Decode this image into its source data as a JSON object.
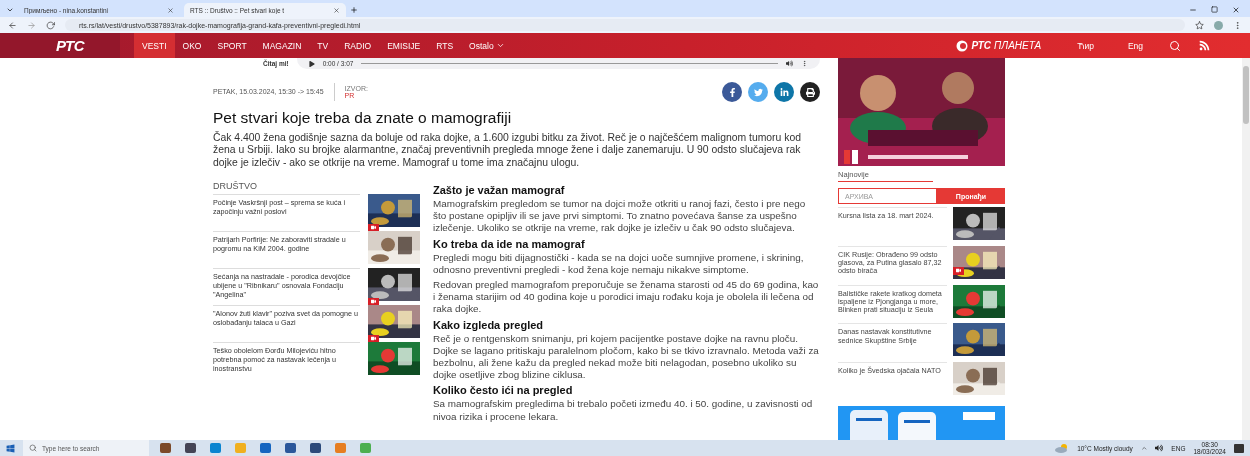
{
  "browser": {
    "tabs": [
      {
        "title": "Примљено - nina.konstantini",
        "selected": false
      },
      {
        "title": "RTS :: Društvo :: Pet stvari koje t",
        "selected": true
      }
    ],
    "url": "rts.rs/lat/vesti/drustvo/5387893/rak-dojke-mamografija-grand-kafa-preventivni-pregledi.html"
  },
  "nav": {
    "logo": "РТС",
    "planeta_logo": [
      "РТС",
      "ПЛАНЕТА"
    ],
    "items": [
      {
        "label": "VESTI",
        "selected": true
      },
      {
        "label": "OKO",
        "selected": false
      },
      {
        "label": "SPORT",
        "selected": false
      },
      {
        "label": "MAGAZIN",
        "selected": false
      },
      {
        "label": "TV",
        "selected": false
      },
      {
        "label": "RADIO",
        "selected": false
      },
      {
        "label": "EMISIJE",
        "selected": false
      },
      {
        "label": "RTS",
        "selected": false
      },
      {
        "label": "Ostalo",
        "selected": false,
        "dropdown": true
      }
    ],
    "script_switch": "Ћир",
    "language": "Eng"
  },
  "player": {
    "label": "Čitaj mi!",
    "time": "0:00 / 3:07"
  },
  "article": {
    "date": "PETAK, 15.03.2024, 15:30 -> 15:45",
    "source_label": "IZVOR:",
    "source": "PR",
    "title": "Pet stvari koje treba da znate o mamografiji",
    "lead": "Čak 4.400 žena godišnje sazna da boluje od raka dojke, a 1.600 izgubi bitku za život. Reč je o najčešćem malignom tumoru kod žena u Srbiji. Iako su brojke alarmantne, značaj preventivnih pregleda mnoge žene i dalje zanemaruju. U 90 odsto slučajeva rak dojke je izlečiv - ako se otkrije na vreme. Mamograf u tome ima značajnu ulogu.",
    "sections": [
      {
        "heading": "Zašto je važan mamograf",
        "paragraphs": [
          "Mamografskim pregledom se tumor na dojci može otkriti u ranoj fazi, često i pre nego što postane opipljiv ili se jave prvi simptomi. To znatno povećava šanse za uspešno izlečenje. Ukoliko se otkrije na vreme, rak dojke je izlečiv u čak 90 odsto slučajeva."
        ]
      },
      {
        "heading": "Ko treba da ide na mamograf",
        "paragraphs": [
          "Pregledi mogu biti dijagnostički - kada se na dojci uoče sumnjive promene, i skrining, odnosno preventivni pregledi - kod žena koje nemaju nikakve simptome.",
          "Redovan pregled mamografom preporučuje se ženama starosti od 45 do 69 godina, kao i ženama starijim od 40 godina koje u porodici imaju rođaku koja je obolela ili lečena od raka dojke."
        ]
      },
      {
        "heading": "Kako izgleda pregled",
        "paragraphs": [
          "Reč je o rentgenskom snimanju, pri kojem pacijentke postave dojke na ravnu ploču. Dojke se lagano pritiskaju paralelnom pločom, kako bi se tkivo izravnalo. Metoda važi za bezbolnu, ali žene kažu da pregled nekad može biti nelagodan, posebno ukoliko su dojke osetljive zbog blizine ciklusa."
        ]
      },
      {
        "heading": "Koliko često ići na pregled",
        "paragraphs": [
          "Sa mamografskim pregledima bi trebalo početi između 40. i 50. godine, u zavisnosti od nivoa rizika i procene lekara."
        ]
      }
    ]
  },
  "related": {
    "heading": "DRUŠTVO",
    "items": [
      {
        "title": "Počinje Vaskršnji post – sprema se kuća i započinju važni poslovi",
        "video": true
      },
      {
        "title": "Patrijarh Porfirije: Ne zaboraviti stradale u pogromu na KiM 2004. godine",
        "video": false
      },
      {
        "title": "Sećanja na nastradale - porodica devojčice ubijene u \"Ribnikaru\" osnovala Fondaciju \"Angelina\"",
        "video": true
      },
      {
        "title": "\"Alonov žuti klavir\" poziva svet da pomogne u oslobađanju talaca u Gazi",
        "video": true
      },
      {
        "title": "Teško obolelom Đorđu Milojeviću hitno potrebna pomoć za nastavak lečenja u inostranstvu",
        "video": false
      }
    ]
  },
  "sidebar": {
    "tab": "Najnovije",
    "search": {
      "placeholder": "АРХИВА",
      "button": "Пронађи"
    },
    "news": [
      {
        "title": "Kursna lista za 18. mart 2024.",
        "video": false
      },
      {
        "title": "CIK Rusije: Obrađeno 99 odsto glasova, za Putina glasalo 87,32 odsto birača",
        "video": true
      },
      {
        "title": "Balističke rakete kratkog dometa ispaljene iz Pjongjanga u more, Blinken prati situaciju iz Seula",
        "video": false
      },
      {
        "title": "Danas nastavak konstitutivne sednice Skupštine Srbije",
        "video": false
      },
      {
        "title": "Koliko je Švedska ojačala NATO",
        "video": false
      }
    ]
  },
  "taskbar": {
    "search_placeholder": "Type here to search",
    "weather": "10°C Mostly cloudy",
    "language": "ENG",
    "time": "08:30",
    "date": "18/03/2024"
  }
}
